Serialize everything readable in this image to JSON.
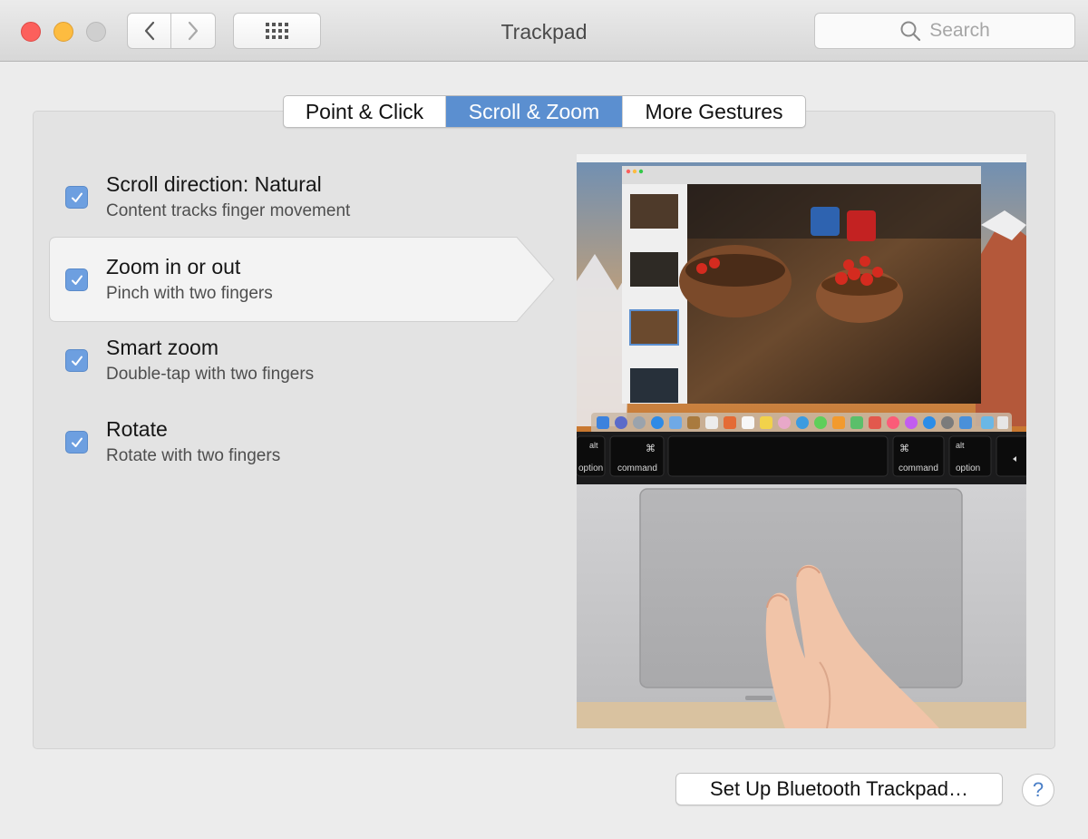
{
  "window": {
    "title": "Trackpad",
    "traffic_lights": {
      "close_color": "#fc605c",
      "minimize_color": "#fdbc40",
      "zoom_color": "#cfcfcf"
    },
    "nav": {
      "back_icon": "chevron-left-icon",
      "forward_icon": "chevron-right-icon",
      "grid_icon": "show-all-grid-icon"
    }
  },
  "search": {
    "placeholder": "Search",
    "icon": "magnifier-icon"
  },
  "tabs": [
    {
      "label": "Point & Click",
      "selected": false
    },
    {
      "label": "Scroll & Zoom",
      "selected": true
    },
    {
      "label": "More Gestures",
      "selected": false
    }
  ],
  "options": [
    {
      "title": "Scroll direction: Natural",
      "subtitle": "Content tracks finger movement",
      "checked": true,
      "highlighted": false
    },
    {
      "title": "Zoom in or out",
      "subtitle": "Pinch with two fingers",
      "checked": true,
      "highlighted": true
    },
    {
      "title": "Smart zoom",
      "subtitle": "Double-tap with two fingers",
      "checked": true,
      "highlighted": false
    },
    {
      "title": "Rotate",
      "subtitle": "Rotate with two fingers",
      "checked": true,
      "highlighted": false
    }
  ],
  "preview": {
    "keys": {
      "left_option_top": "alt",
      "left_option_bottom": "option",
      "left_command_symbol": "⌘",
      "left_command_label": "command",
      "right_command_symbol": "⌘",
      "right_command_label": "command",
      "right_option_top": "alt",
      "right_option_bottom": "option"
    }
  },
  "buttons": {
    "bluetooth": "Set Up Bluetooth Trackpad…",
    "help": "?"
  },
  "colors": {
    "accent": "#5b8fd0",
    "checkbox": "#6d9fe0",
    "window_bg": "#ececec"
  }
}
